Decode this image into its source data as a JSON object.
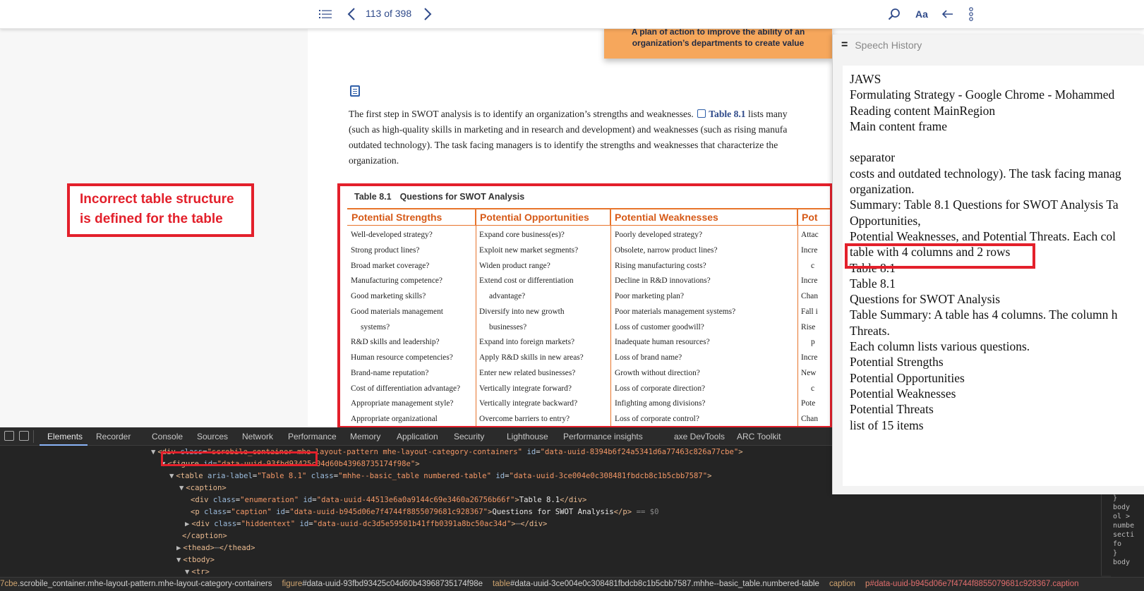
{
  "toolbar": {
    "page_counter": "113 of 398",
    "font_button": "Aa"
  },
  "content": {
    "definition_box": [
      "A plan of action to improve the ability of an",
      "organization’s departments to create value"
    ],
    "paragraph": {
      "line1_pre": "The first step in SWOT analysis is to identify an organization’s strengths and weaknesses.",
      "line1_link": "Table 8.1",
      "line1_post": "lists many",
      "line2": "(such as high-quality skills in marketing and in research and development) and weaknesses (such as rising manufa",
      "line3": "outdated technology). The task facing managers is to identify the strengths and weaknesses that characterize the",
      "line4": "organization."
    },
    "annotation": [
      "Incorrect table structure",
      "is defined for the table"
    ]
  },
  "table": {
    "number": "Table 8.1",
    "title": "Questions for SWOT Analysis",
    "headers": [
      "Potential Strengths",
      "Potential Opportunities",
      "Potential Weaknesses",
      "Pot"
    ],
    "strengths": [
      "Well-developed strategy?",
      "Strong product lines?",
      "Broad market coverage?",
      "Manufacturing competence?",
      "Good marketing skills?",
      "Good materials management",
      "systems?",
      "R&D skills and leadership?",
      "Human resource competencies?",
      "Brand-name reputation?",
      "Cost of differentiation advantage?",
      "Appropriate management style?",
      "Appropriate organizational"
    ],
    "opportunities": [
      "Expand core business(es)?",
      "Exploit new market segments?",
      "Widen product range?",
      "Extend cost or differentiation",
      "advantage?",
      "Diversify into new growth",
      "businesses?",
      "Expand into foreign markets?",
      "Apply R&D skills in new areas?",
      "Enter new related businesses?",
      "Vertically integrate forward?",
      "Vertically integrate backward?",
      "Overcome barriers to entry?"
    ],
    "weaknesses": [
      "Poorly developed strategy?",
      "Obsolete, narrow product lines?",
      "Rising manufacturing costs?",
      "Decline in R&D innovations?",
      "Poor marketing plan?",
      "Poor materials management systems?",
      "Loss of customer goodwill?",
      "Inadequate human resources?",
      "Loss of brand name?",
      "Growth without direction?",
      "Loss of corporate direction?",
      "Infighting among divisions?",
      "Loss of corporate control?"
    ],
    "threats": [
      "Attac",
      "Incre",
      "c",
      "Incre",
      "Chan",
      "Fall i",
      "Rise",
      "p",
      "Incre",
      "New",
      "c",
      "Pote",
      "Chan"
    ]
  },
  "speech": {
    "title": "Speech History",
    "lines": [
      "JAWS",
      "Formulating Strategy - Google Chrome - Mohammed",
      "Reading content MainRegion",
      "Main content frame",
      "",
      "separator",
      "costs and outdated technology). The task facing manag",
      "organization.",
      "Summary: Table 8.1 Questions for SWOT Analysis Ta",
      "Opportunities,",
      "Potential Weaknesses, and Potential Threats. Each col",
      "table with 4 columns and 2 rows",
      "Table 8.1",
      "Table 8.1",
      "Questions for SWOT Analysis",
      "Table Summary: A table has 4 columns. The column h",
      "Threats.",
      "Each column lists various questions.",
      "Potential Strengths",
      "Potential Opportunities",
      "Potential Weaknesses",
      "Potential Threats",
      "list of 15 items"
    ]
  },
  "devtools": {
    "tabs": [
      "Elements",
      "Recorder",
      "Console",
      "Sources",
      "Network",
      "Performance",
      "Memory",
      "Application",
      "Security",
      "Lighthouse",
      "Performance insights",
      "axe DevTools",
      "ARC Toolkit"
    ],
    "tree": {
      "l1_div_class": "scrobile_container mhe-layout-pattern mhe-layout-category-containers",
      "l1_div_id": "data-uuid-8394b6f24a5341d6a77463c826a77cbe",
      "l2_figure_id": "data-uuid-93fbd93425c04d60b43968735174f98e",
      "l3_aria": "Table 8.1",
      "l3_class": "mhhe--basic_table numbered-table",
      "l3_id": "data-uuid-3ce004e0c308481fbdcb8c1b5cbb7587",
      "l5_class": "enumeration",
      "l5_id": "data-uuid-44513e6a0a9144c69e3460a26756b66f",
      "l5_text": "Table 8.1",
      "l6_class": "caption",
      "l6_id": "data-uuid-b945d06e7f4744f8855079681c928367",
      "l6_text": "Questions for SWOT Analysis",
      "l6_suffix": "== $0",
      "l7_class": "hiddentext",
      "l7_id": "data-uuid-dc3d5e59501b41ffb0391a8bc50ac34d"
    },
    "side": [
      "}",
      "body",
      "ol >",
      "numbe",
      "secti",
      "fo",
      "}",
      "body"
    ],
    "breadcrumbs": [
      {
        "tag": "7cbe",
        "rest": ".scrobile_container.mhe-layout-pattern.mhe-layout-category-containers"
      },
      {
        "tag": "figure",
        "rest": "#data-uuid-93fbd93425c04d60b43968735174f98e"
      },
      {
        "tag": "table",
        "rest": "#data-uuid-3ce004e0c308481fbdcb8c1b5cbb7587.mhhe--basic_table.numbered-table"
      },
      {
        "tag": "caption",
        "rest": ""
      },
      {
        "tag": "p",
        "rest": "#data-uuid-b945d06e7f4744f8855079681c928367.caption"
      }
    ]
  }
}
